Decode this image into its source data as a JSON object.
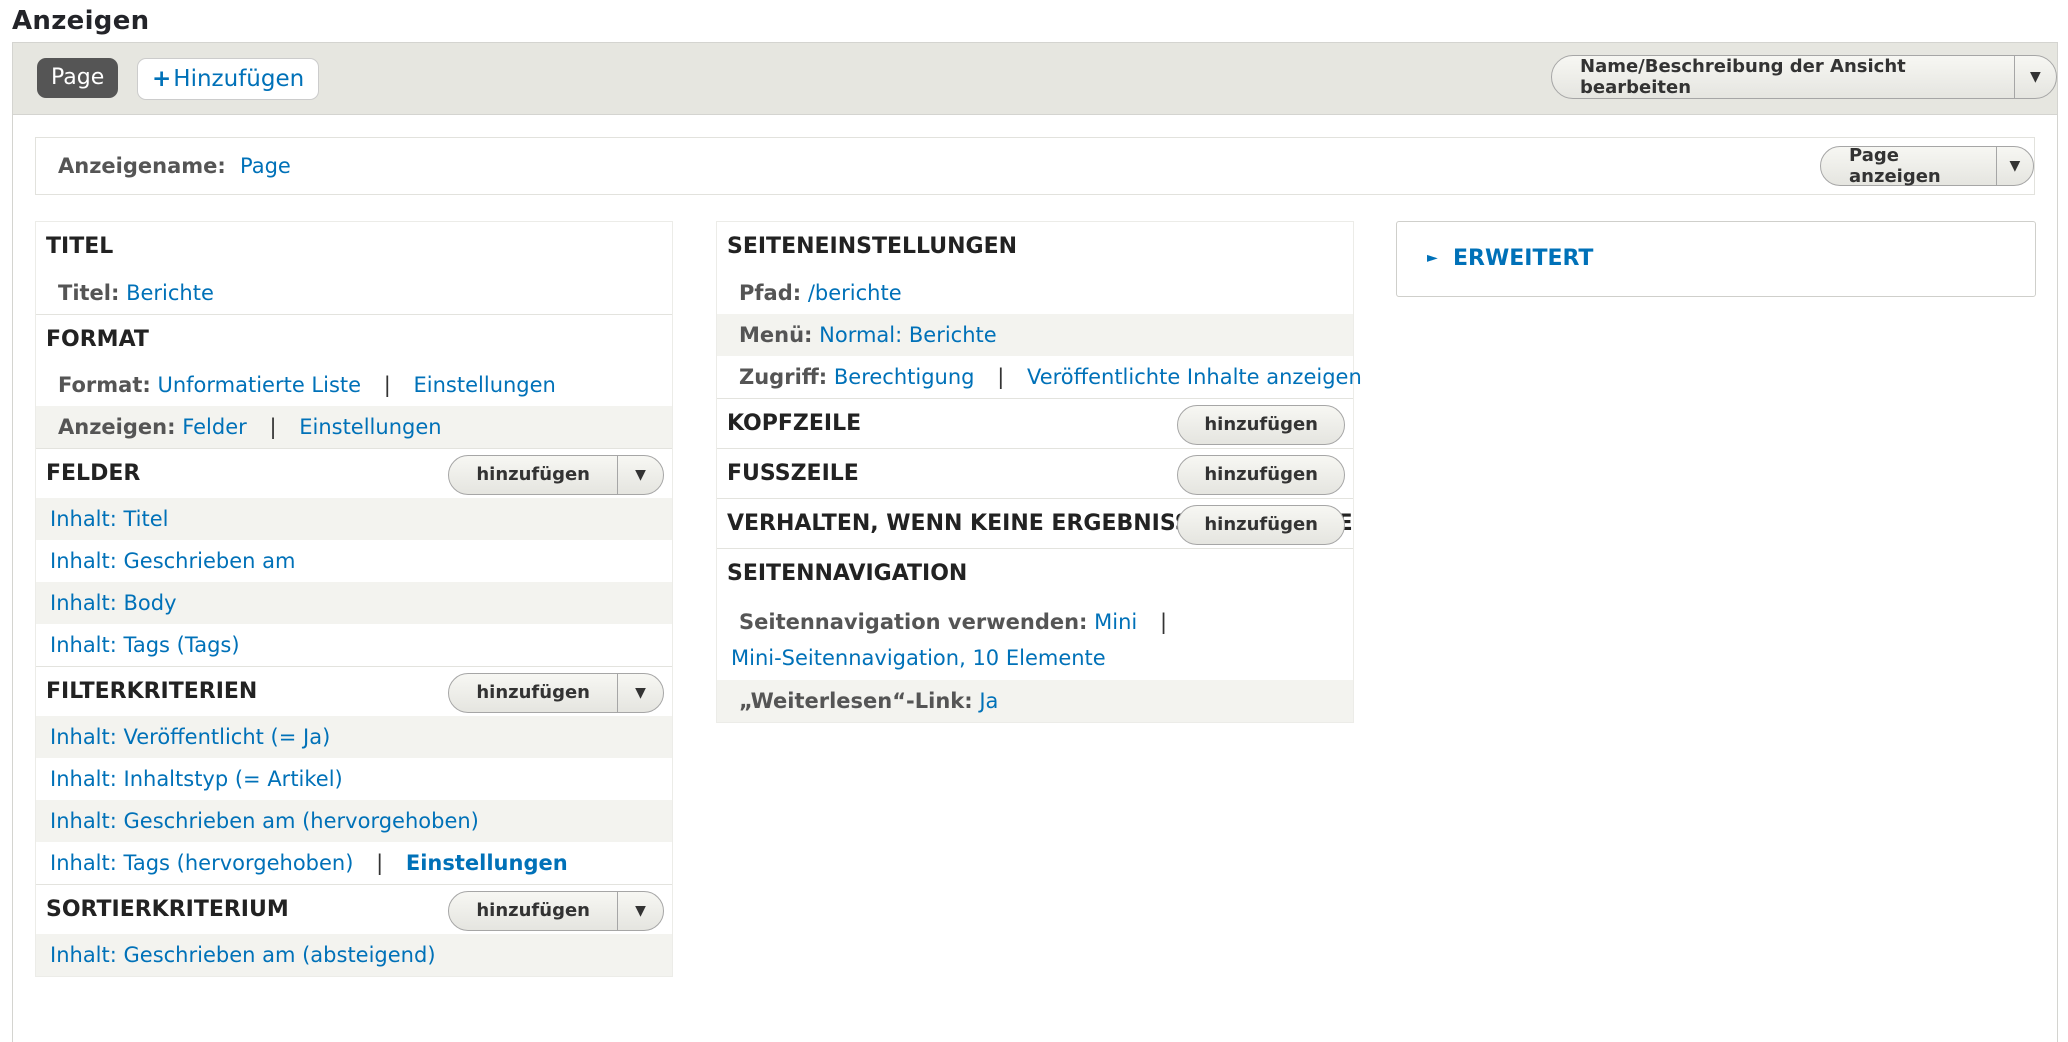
{
  "page_title": "Anzeigen",
  "tabs": {
    "active": "Page",
    "add_plus": "+",
    "add_label": "Hinzufügen"
  },
  "edit_name_button": "Name/Beschreibung der Ansicht bearbeiten",
  "display_name": {
    "label": "Anzeigename:",
    "value": "Page",
    "show_button": "Page anzeigen"
  },
  "column1": {
    "titel": {
      "heading": "TITEL",
      "label": "Titel:",
      "value": "Berichte"
    },
    "format": {
      "heading": "FORMAT",
      "format_label": "Format:",
      "format_value": "Unformatierte Liste",
      "format_settings": "Einstellungen",
      "show_label": "Anzeigen:",
      "show_value": "Felder",
      "show_settings": "Einstellungen"
    },
    "felder": {
      "heading": "FELDER",
      "add_button": "hinzufügen",
      "items": [
        "Inhalt: Titel",
        "Inhalt: Geschrieben am",
        "Inhalt: Body",
        "Inhalt: Tags (Tags)"
      ]
    },
    "filter": {
      "heading": "FILTERKRITERIEN",
      "add_button": "hinzufügen",
      "items": [
        "Inhalt: Veröffentlicht (= Ja)",
        "Inhalt: Inhaltstyp (= Artikel)",
        "Inhalt: Geschrieben am (hervorgehoben)",
        "Inhalt: Tags (hervorgehoben)"
      ],
      "settings": "Einstellungen"
    },
    "sort": {
      "heading": "SORTIERKRITERIUM",
      "add_button": "hinzufügen",
      "items": [
        "Inhalt: Geschrieben am (absteigend)"
      ]
    }
  },
  "column2": {
    "page_settings": {
      "heading": "SEITENEINSTELLUNGEN",
      "path_label": "Pfad:",
      "path_value": "/berichte",
      "menu_label": "Menü:",
      "menu_value": "Normal: Berichte",
      "access_label": "Zugriff:",
      "access_value": "Berechtigung",
      "access_extra": "Veröffentlichte Inhalte anzeigen"
    },
    "header": {
      "heading": "KOPFZEILE",
      "add_button": "hinzufügen"
    },
    "footer": {
      "heading": "FUSSZEILE",
      "add_button": "hinzufügen"
    },
    "no_results": {
      "heading": "VERHALTEN, WENN KEINE ERGEBNISSE VORHANDEN SIND",
      "add_button": "hinzufügen"
    },
    "pager": {
      "heading": "SEITENNAVIGATION",
      "use_label": "Seitennavigation verwenden:",
      "use_value": "Mini",
      "detail": "Mini-Seitennavigation, 10 Elemente",
      "more_label": "„Weiterlesen“-Link:",
      "more_value": "Ja"
    }
  },
  "advanced": {
    "label": "ERWEITERT",
    "icon": "►"
  },
  "separator": "|",
  "caret": "▼",
  "colors": {
    "link": "#0071b8",
    "tab_bar": "#e6e6e0",
    "active_tab": "#555555"
  }
}
